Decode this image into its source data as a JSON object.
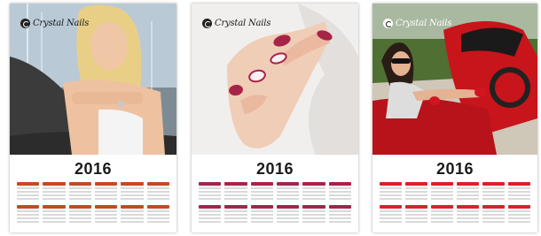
{
  "posters": [
    {
      "logo": "Crystal Nails",
      "year": "2016",
      "accent": "#c34a23"
    },
    {
      "logo": "Crystal Nails",
      "year": "2016",
      "accent": "#a4244a"
    },
    {
      "logo": "Crystal Nails",
      "year": "2016",
      "accent": "#d8222a"
    }
  ]
}
